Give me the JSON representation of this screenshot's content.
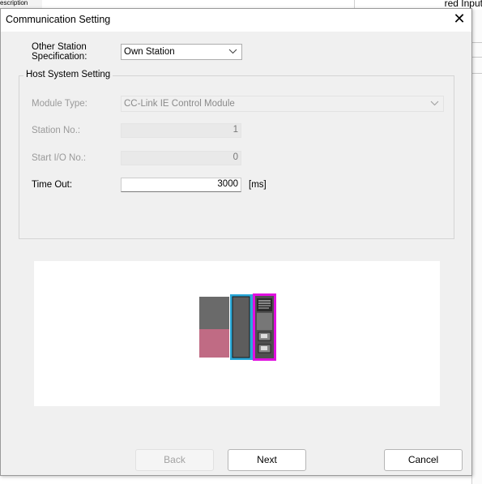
{
  "background": {
    "top_left_fragment": "escription",
    "top_right_fragment": "red Input"
  },
  "dialog": {
    "title": "Communication Setting",
    "close_glyph": "✕"
  },
  "other_station": {
    "label_line1": "Other Station",
    "label_line2": "Specification:",
    "value": "Own Station"
  },
  "host_system": {
    "group_title": "Host System Setting",
    "module_type": {
      "label": "Module Type:",
      "value": "CC-Link IE Control Module"
    },
    "station_no": {
      "label": "Station No.:",
      "value": "1"
    },
    "start_io_no": {
      "label": "Start I/O No.:",
      "value": "0"
    },
    "time_out": {
      "label": "Time Out:",
      "value": "3000",
      "unit": "[ms]"
    }
  },
  "preview": {
    "colors": {
      "cpu_module": "#6a6a6a",
      "cpu_lower": "#c06b84",
      "network_module_border": "#2aa8d8",
      "network_module_fill": "#5d5d5d",
      "highlight_border": "#e010e0",
      "highlight_fill": "#4f4f4f"
    }
  },
  "buttons": {
    "back": "Back",
    "next": "Next",
    "cancel": "Cancel"
  }
}
